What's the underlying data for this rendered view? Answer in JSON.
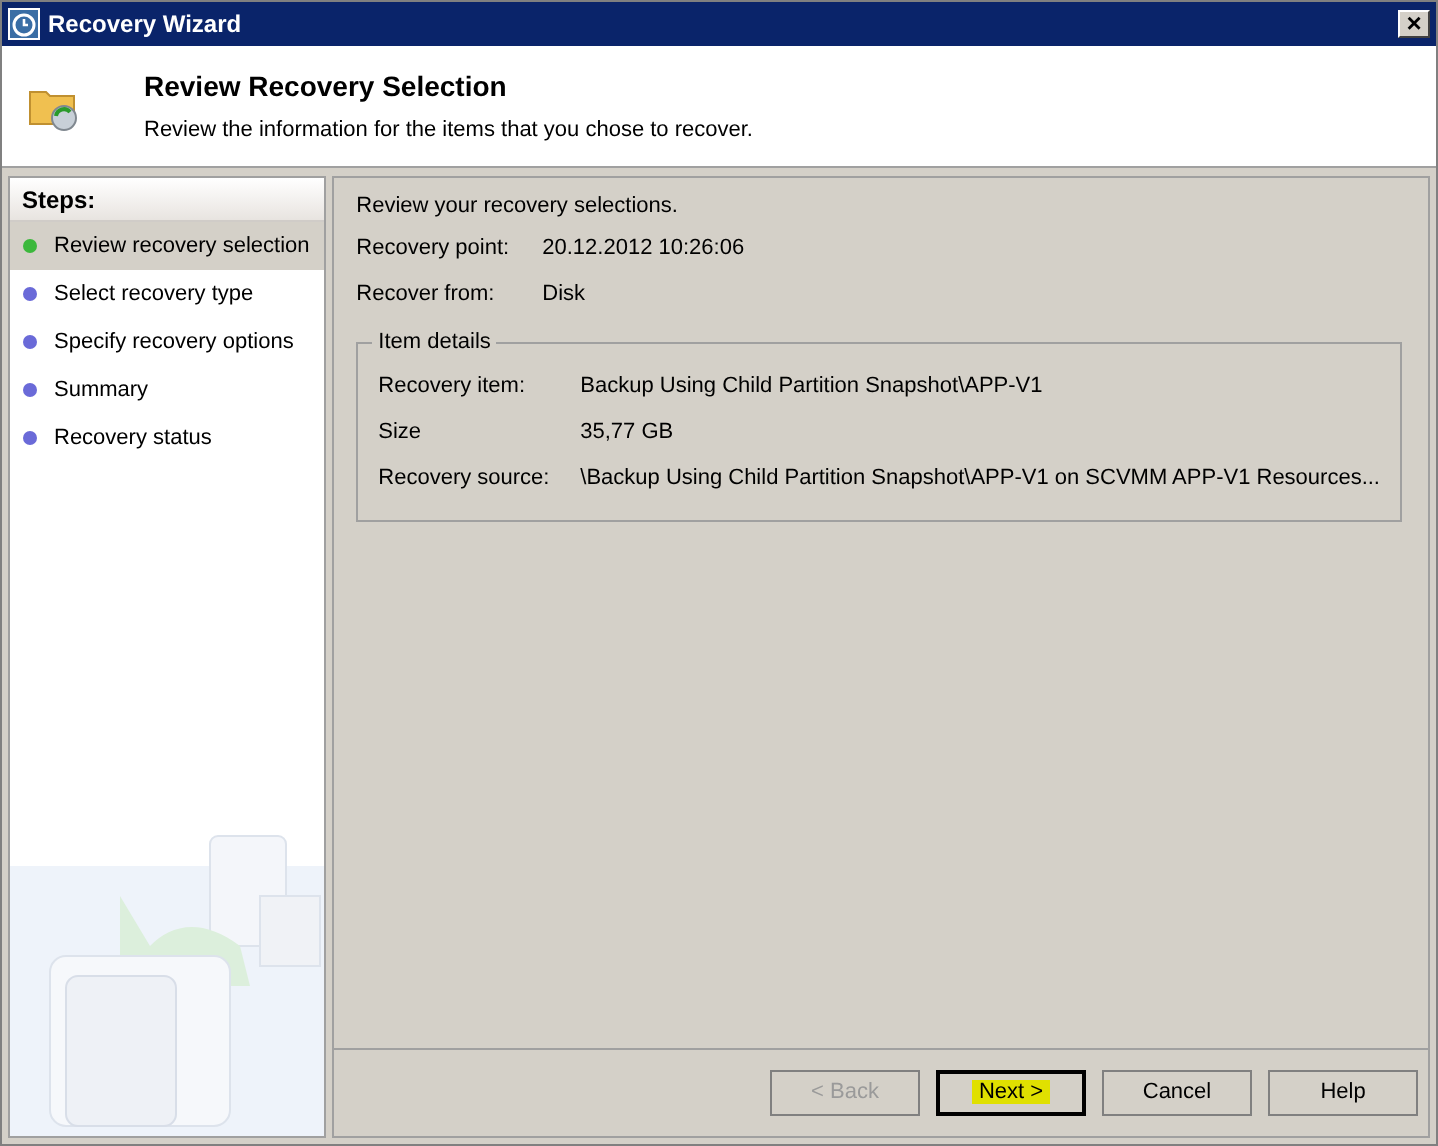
{
  "window": {
    "title": "Recovery Wizard",
    "close": "×"
  },
  "header": {
    "title": "Review Recovery Selection",
    "subtitle": "Review the information for the items that you chose to recover."
  },
  "steps": {
    "title": "Steps:",
    "items": [
      {
        "label": "Review recovery selection",
        "selected": true
      },
      {
        "label": "Select recovery type",
        "selected": false
      },
      {
        "label": "Specify recovery options",
        "selected": false
      },
      {
        "label": "Summary",
        "selected": false
      },
      {
        "label": "Recovery status",
        "selected": false
      }
    ]
  },
  "content": {
    "intro": "Review your recovery selections.",
    "fields": [
      {
        "label": "Recovery point:",
        "value": "20.12.2012 10:26:06"
      },
      {
        "label": "Recover from:",
        "value": "Disk"
      }
    ],
    "item_details": {
      "title": "Item details",
      "fields": [
        {
          "label": "Recovery item:",
          "value": "Backup Using Child Partition Snapshot\\APP-V1"
        },
        {
          "label": "Size",
          "value": "35,77 GB"
        },
        {
          "label": "Recovery source:",
          "value": "\\Backup Using Child Partition Snapshot\\APP-V1 on SCVMM APP-V1 Resources..."
        }
      ]
    }
  },
  "buttons": [
    {
      "label": "< Back",
      "disabled": true,
      "highlighted": false,
      "default": false
    },
    {
      "label": "Next >",
      "disabled": false,
      "highlighted": true,
      "default": true
    },
    {
      "label": "Cancel",
      "disabled": false,
      "highlighted": false,
      "default": false
    },
    {
      "label": "Help",
      "disabled": false,
      "highlighted": false,
      "default": false
    }
  ]
}
